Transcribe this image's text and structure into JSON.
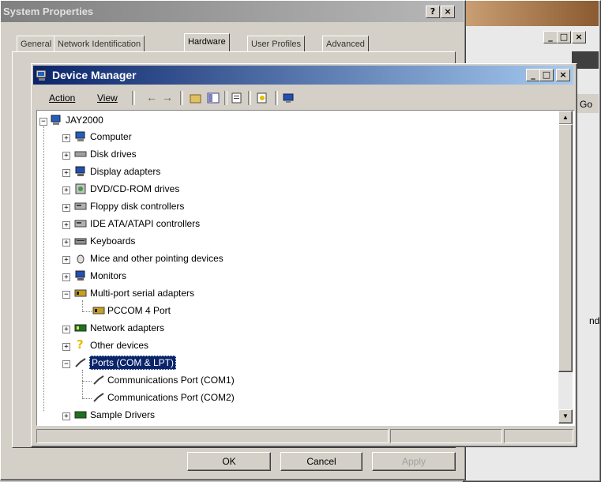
{
  "background_window": {
    "title": "System Properties",
    "help_btn": "?",
    "close_btn": "×",
    "tabs": [
      "General",
      "Network Identification",
      "Hardware",
      "User Profiles",
      "Advanced"
    ],
    "buttons": {
      "ok": "OK",
      "cancel": "Cancel",
      "apply": "Apply"
    }
  },
  "right_window": {
    "go_label": "Go",
    "partial_text": "nd",
    "min": "_",
    "max": "□",
    "close": "×"
  },
  "device_manager": {
    "title": "Device Manager",
    "min": "_",
    "max": "□",
    "close": "×",
    "menu": {
      "action": "Action",
      "view": "View"
    },
    "toolbar": {
      "back": "←",
      "forward": "→"
    },
    "tree": {
      "root": "JAY2000",
      "nodes": [
        "Computer",
        "Disk drives",
        "Display adapters",
        "DVD/CD-ROM drives",
        "Floppy disk controllers",
        "IDE ATA/ATAPI controllers",
        "Keyboards",
        "Mice and other pointing devices",
        "Monitors",
        "Multi-port serial adapters",
        "PCCOM 4 Port",
        "Network adapters",
        "Other devices",
        "Ports (COM & LPT)",
        "Communications Port (COM1)",
        "Communications Port (COM2)",
        "Sample Drivers"
      ],
      "expander_plus": "+",
      "expander_minus": "−"
    },
    "scroll": {
      "up": "▲",
      "down": "▼"
    }
  },
  "colors": {
    "titlebar_active": "#0a246a",
    "titlebar_gradient_end": "#a6caf0",
    "titlebar_inactive": "#a0a0a0",
    "selection": "#0a246a"
  }
}
